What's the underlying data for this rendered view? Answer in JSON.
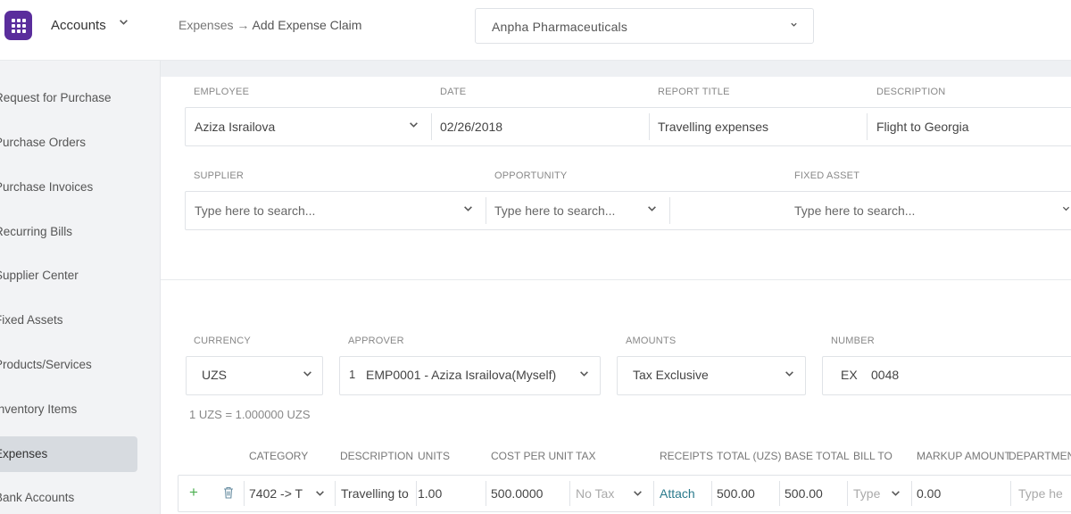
{
  "brand": {
    "title": "Accounts"
  },
  "sidebar": {
    "items": [
      {
        "label": "Request for Purchase"
      },
      {
        "label": "Purchase Orders"
      },
      {
        "label": "Purchase Invoices"
      },
      {
        "label": "Recurring Bills"
      },
      {
        "label": "Supplier Center"
      },
      {
        "label": "Fixed Assets"
      },
      {
        "label": "Products/Services"
      },
      {
        "label": "Inventory Items"
      },
      {
        "label": "Expenses"
      },
      {
        "label": "Bank Accounts"
      }
    ],
    "active": "Expenses"
  },
  "breadcrumb": {
    "parent": "Expenses",
    "arrow": "→",
    "current": "Add Expense Claim"
  },
  "company": {
    "name": "Anpha Pharmaceuticals"
  },
  "form": {
    "employee": {
      "label": "EMPLOYEE",
      "value": "Aziza Israilova"
    },
    "date": {
      "label": "DATE",
      "value": "02/26/2018"
    },
    "report_title": {
      "label": "REPORT TITLE",
      "value": "Travelling expenses"
    },
    "description": {
      "label": "DESCRIPTION",
      "value": "Flight to Georgia"
    },
    "supplier": {
      "label": "SUPPLIER",
      "placeholder": "Type here to search..."
    },
    "opportunity": {
      "label": "OPPORTUNITY",
      "placeholder": "Type here to search..."
    },
    "fixed_asset": {
      "label": "FIXED ASSET",
      "placeholder": "Type here to search..."
    },
    "currency": {
      "label": "CURRENCY",
      "value": "UZS"
    },
    "approver": {
      "label": "APPROVER",
      "index": "1",
      "value": "EMP0001 - Aziza Israilova(Myself)"
    },
    "amounts": {
      "label": "AMOUNTS",
      "value": "Tax Exclusive"
    },
    "number": {
      "label": "NUMBER",
      "prefix": "EX",
      "value": "0048"
    },
    "rate_note": "1 UZS = 1.000000 UZS"
  },
  "table": {
    "columns": [
      "CATEGORY",
      "DESCRIPTION",
      "UNITS",
      "COST PER UNIT",
      "TAX",
      "RECEIPTS",
      "TOTAL (UZS)",
      "BASE TOTAL",
      "BILL TO",
      "MARKUP AMOUNT",
      "DEPARTMENT"
    ],
    "row": {
      "category": "7402 -> T",
      "description": "Travelling to",
      "units": "1.00",
      "cost_per_unit": "500.0000",
      "tax": "No Tax",
      "receipts": "Attach",
      "total": "500.00",
      "base_total": "500.00",
      "bill_to": "Type",
      "markup": "0.00",
      "department": "Type he"
    }
  },
  "colors": {
    "brand": "#5a2d9c",
    "active_nav": "#d7dbe0",
    "link": "#2a7a8c",
    "add": "#4caf50"
  }
}
